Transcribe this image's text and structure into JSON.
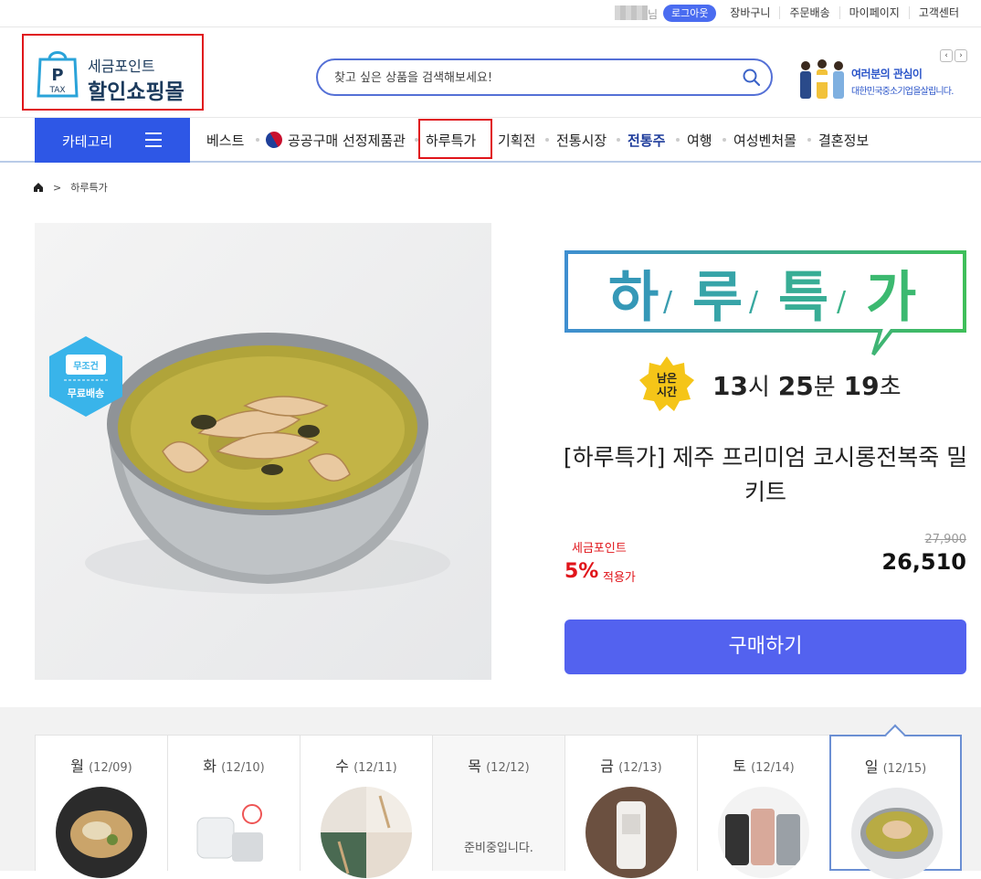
{
  "topbar": {
    "user_suffix": "님",
    "logout": "로그아웃",
    "links": [
      "장바구니",
      "주문배송",
      "마이페이지",
      "고객센터"
    ]
  },
  "logo": {
    "bag_letter": "P",
    "bag_sub": "TAX",
    "line1": "세금포인트",
    "line2": "할인쇼핑몰"
  },
  "search": {
    "placeholder": "찾고 싶은 상품을 검색해보세요!",
    "icon": "search-icon"
  },
  "banner": {
    "line1": "여러분의 관심이",
    "line2": "대한민국중소기업을살립니다.",
    "prev": "‹",
    "next": "›"
  },
  "nav": {
    "category_label": "카테고리",
    "items": [
      "베스트",
      "공공구매 선정제품관",
      "하루특가",
      "기획전",
      "전통시장",
      "전통주",
      "여행",
      "여성벤처몰",
      "결혼정보"
    ]
  },
  "breadcrumb": {
    "current": "하루특가"
  },
  "badge": {
    "line1": "무조건",
    "line2": "무료배송"
  },
  "deal": {
    "title_chars": [
      "하",
      "루",
      "특",
      "가"
    ],
    "timer_badge": [
      "남은",
      "시간"
    ],
    "hours": "13",
    "hours_unit": "시",
    "minutes": "25",
    "minutes_unit": "분",
    "seconds": "19",
    "seconds_unit": "초",
    "product_name": "[하루특가] 제주 프리미엄 코시롱전복죽 밀키트",
    "point_label": "세금포인트",
    "point_percent": "5%",
    "point_apply": "적용가",
    "original_price": "27,900",
    "sale_price": "26,510",
    "buy_label": "구매하기"
  },
  "week": [
    {
      "day": "월",
      "date": "(12/09)",
      "ready": ""
    },
    {
      "day": "화",
      "date": "(12/10)",
      "ready": ""
    },
    {
      "day": "수",
      "date": "(12/11)",
      "ready": ""
    },
    {
      "day": "목",
      "date": "(12/12)",
      "ready": "준비중입니다."
    },
    {
      "day": "금",
      "date": "(12/13)",
      "ready": ""
    },
    {
      "day": "토",
      "date": "(12/14)",
      "ready": ""
    },
    {
      "day": "일",
      "date": "(12/15)",
      "ready": ""
    }
  ],
  "colors": {
    "accent_blue": "#2e57e6",
    "buy_button": "#5362ef",
    "point_red": "#e0141a"
  }
}
